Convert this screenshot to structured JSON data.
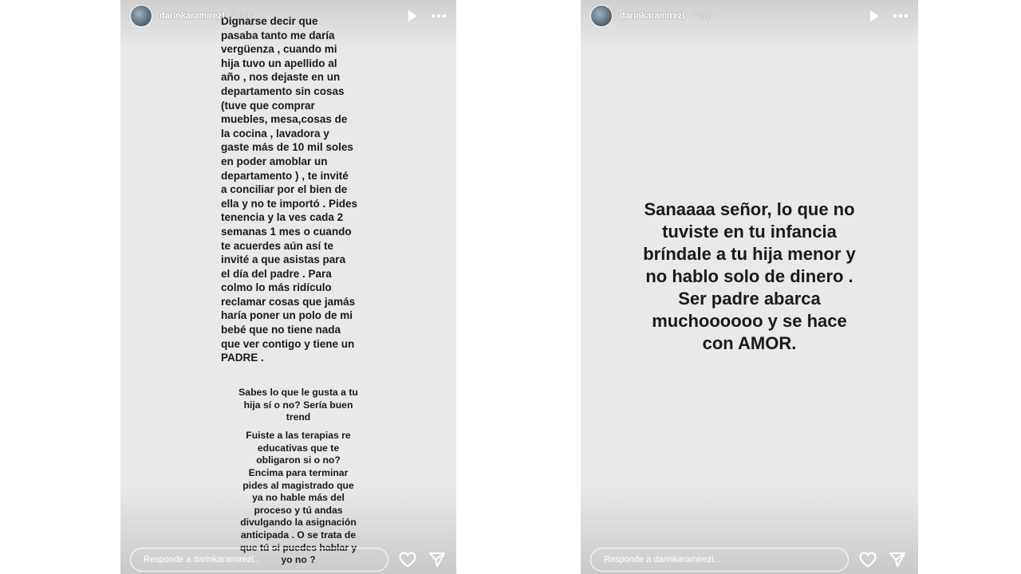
{
  "stories": [
    {
      "username": "darinkaramirezl",
      "time": "7 min",
      "text_main": "Dignarse decir que\npasaba tanto me daría\nvergüenza , cuando mi\nhija tuvo un apellido al\naño , nos dejaste en un\ndepartamento sin cosas\n(tuve que comprar\nmuebles, mesa,cosas de\nla cocina , lavadora y\ngaste más de 10 mil soles\nen poder amoblar un\ndepartamento ) , te invité\na conciliar por el bien de\nella y no te importó . Pides\ntenencia y la ves cada 2\nsemanas 1 mes o cuando\nte acuerdes aún así te\ninvité a que asistas para\nel día del padre . Para\ncolmo lo más ridículo\nreclamar cosas que jamás\nharía poner un polo de mi\nbebé que no tiene nada\nque ver contigo  y tiene un\nPADRE .",
      "text_q1": "Sabes lo que le gusta a tu\nhija sí o no? Sería buen\ntrend",
      "text_q2": "Fuiste a las terapias re\neducativas que te\nobligaron si o no?",
      "text_q3": "Encima para terminar\npides al magistrado que\nya no hable más del\nproceso y tú andas\ndivulgando la asignación\nanticipada . O se trata de\nque tú si puedes hablar y\nyo no ?",
      "reply_placeholder": "Responde a darinkaramirezl..."
    },
    {
      "username": "darinkaramirezl",
      "time": "7 min",
      "text_main": "Sanaaaa señor, lo que no\ntuviste en tu infancia\nbríndale a tu hija menor y\nno hablo solo de dinero .\nSer padre abarca\nmuchoooooo y se hace\ncon AMOR.",
      "reply_placeholder": "Responde a darinkaramirezl..."
    }
  ],
  "icons": {
    "play": "play-icon",
    "more": "more-icon",
    "like": "heart-icon",
    "share": "send-icon"
  },
  "colors": {
    "story_background": "#e9e9e9",
    "text": "#1a1a1a",
    "overlay_text": "#ffffff"
  }
}
